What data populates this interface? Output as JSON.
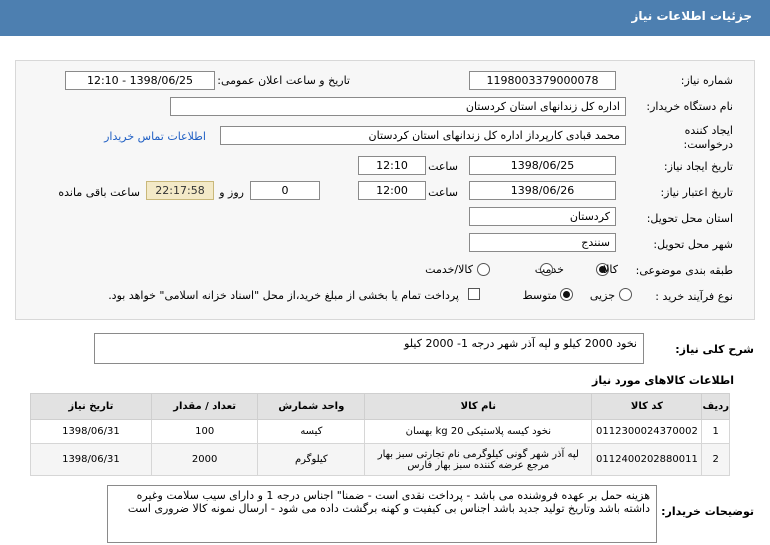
{
  "header": {
    "title": "جزئیات اطلاعات نیاز"
  },
  "form": {
    "need_number": {
      "label": "شماره نیاز:",
      "value": "1198003379000078"
    },
    "announce_datetime": {
      "label": "تاریخ و ساعت اعلان عمومی:",
      "value": "1398/06/25 - 12:10"
    },
    "buyer_org": {
      "label": "نام دستگاه خریدار:",
      "value": "اداره کل زندانهای استان کردستان"
    },
    "requester": {
      "label": "ایجاد کننده درخواست:",
      "value": "محمد  قبادی کارپرداز اداره کل زندانهای استان کردستان",
      "link": "اطلاعات تماس خریدار"
    },
    "creation": {
      "label": "تاریخ ایجاد نیاز:",
      "date": "1398/06/25",
      "time_label": "ساعت",
      "time": "12:10"
    },
    "validity": {
      "label": "تاریخ اعتبار نیاز:",
      "date": "1398/06/26",
      "time_label": "ساعت",
      "time": "12:00",
      "days": "0",
      "days_label": "روز و",
      "remaining": "22:17:58",
      "remaining_label": "ساعت باقی مانده"
    },
    "province": {
      "label": "استان محل تحویل:",
      "value": "کردستان"
    },
    "city": {
      "label": "شهر محل تحویل:",
      "value": "سنندج"
    },
    "category": {
      "label": "طبقه بندی موضوعی:",
      "options": [
        "کالا",
        "خدمت",
        "کالا/خدمت"
      ],
      "selected": "کالا"
    },
    "process": {
      "label": "نوع فرآیند خرید :",
      "options": [
        "جزیی",
        "متوسط"
      ],
      "selected": "متوسط",
      "payment_note": "پرداخت تمام یا بخشی از مبلغ خرید،از محل \"اسناد خزانه اسلامی\" خواهد بود."
    }
  },
  "summary": {
    "label": "شرح کلی نیاز:",
    "value": "نخود 2000 کیلو و لپه آذر شهر درجه 1-   2000 کیلو"
  },
  "goods": {
    "title": "اطلاعات کالاهای مورد نیاز",
    "columns": [
      "ردیف",
      "کد کالا",
      "نام کالا",
      "واحد شمارش",
      "تعداد / مقدار",
      "تاریخ نیاز"
    ],
    "rows": [
      [
        "1",
        "0112300024370002",
        "نخود کیسه پلاستیکی 20 kg بهسان",
        "کیسه",
        "100",
        "1398/06/31"
      ],
      [
        "2",
        "0112400202880011",
        "لپه آذر شهر گونی کیلوگرمی نام تجارتی سبز بهار مرجع عرضه کننده سبز بهار فارس",
        "کیلوگرم",
        "2000",
        "1398/06/31"
      ]
    ]
  },
  "buyer_notes": {
    "label": "توضیحات خریدار:",
    "value": "هزینه حمل بر عهده فروشنده می باشد - پرداخت نقدی است -  ضمنا\" اجناس درجه 1 و دارای  سیب سلامت وغیره داشته باشد  وتاریخ تولید  جدید باشد اجناس  بی کیفیت و کهنه  برگشت داده می شود  -  ارسال نمونه کالا ضروری است"
  },
  "colors": {
    "header_bg": "#4d7fb0",
    "link": "#1f5fc4",
    "timer_bg": "#f3e9c7"
  }
}
